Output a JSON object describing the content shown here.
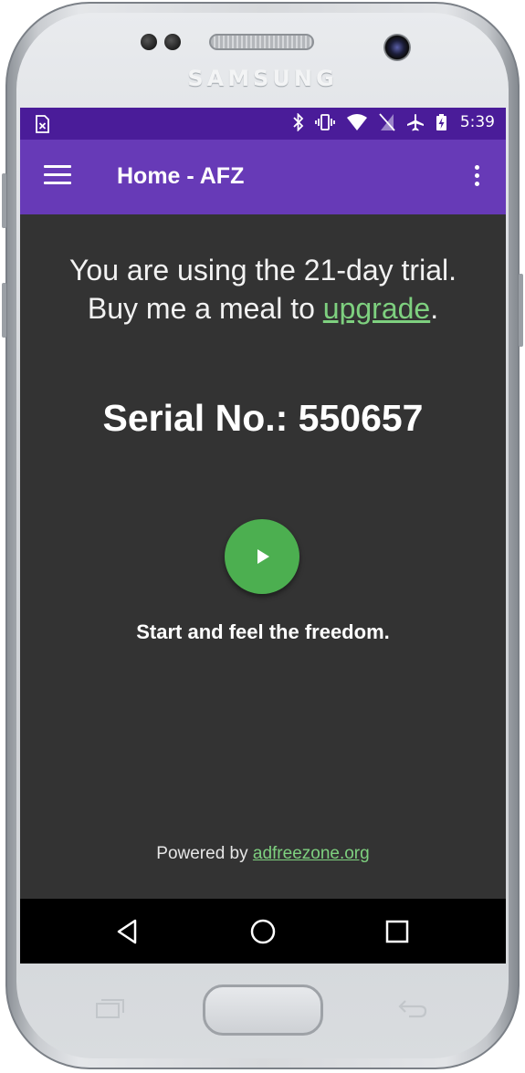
{
  "device": {
    "brand": "SAMSUNG"
  },
  "status_bar": {
    "time": "5:39",
    "icons": [
      "sim-missing-icon",
      "bluetooth-icon",
      "vibrate-icon",
      "wifi-icon",
      "no-sim-icon",
      "airplane-icon",
      "battery-charging-icon"
    ]
  },
  "app_bar": {
    "title": "Home - AFZ",
    "menu_icon": "hamburger-menu-icon",
    "overflow_icon": "more-vert-icon",
    "color": "#673ab7",
    "status_color": "#4a1c99"
  },
  "main": {
    "trial_line1": "You are using the 21-day trial.",
    "trial_line2_prefix": "Buy me a meal to ",
    "upgrade_link": "upgrade",
    "trial_line2_suffix": ".",
    "serial": "Serial No.: 550657",
    "start_button_icon": "play-icon",
    "start_button_color": "#4caf50",
    "tagline": "Start and feel the freedom.",
    "powered_prefix": "Powered by ",
    "powered_link": "adfreezone.org",
    "link_color": "#7ed07f",
    "background": "#333333"
  },
  "nav_bar": {
    "buttons": [
      "back-icon",
      "home-icon",
      "recents-icon"
    ]
  }
}
